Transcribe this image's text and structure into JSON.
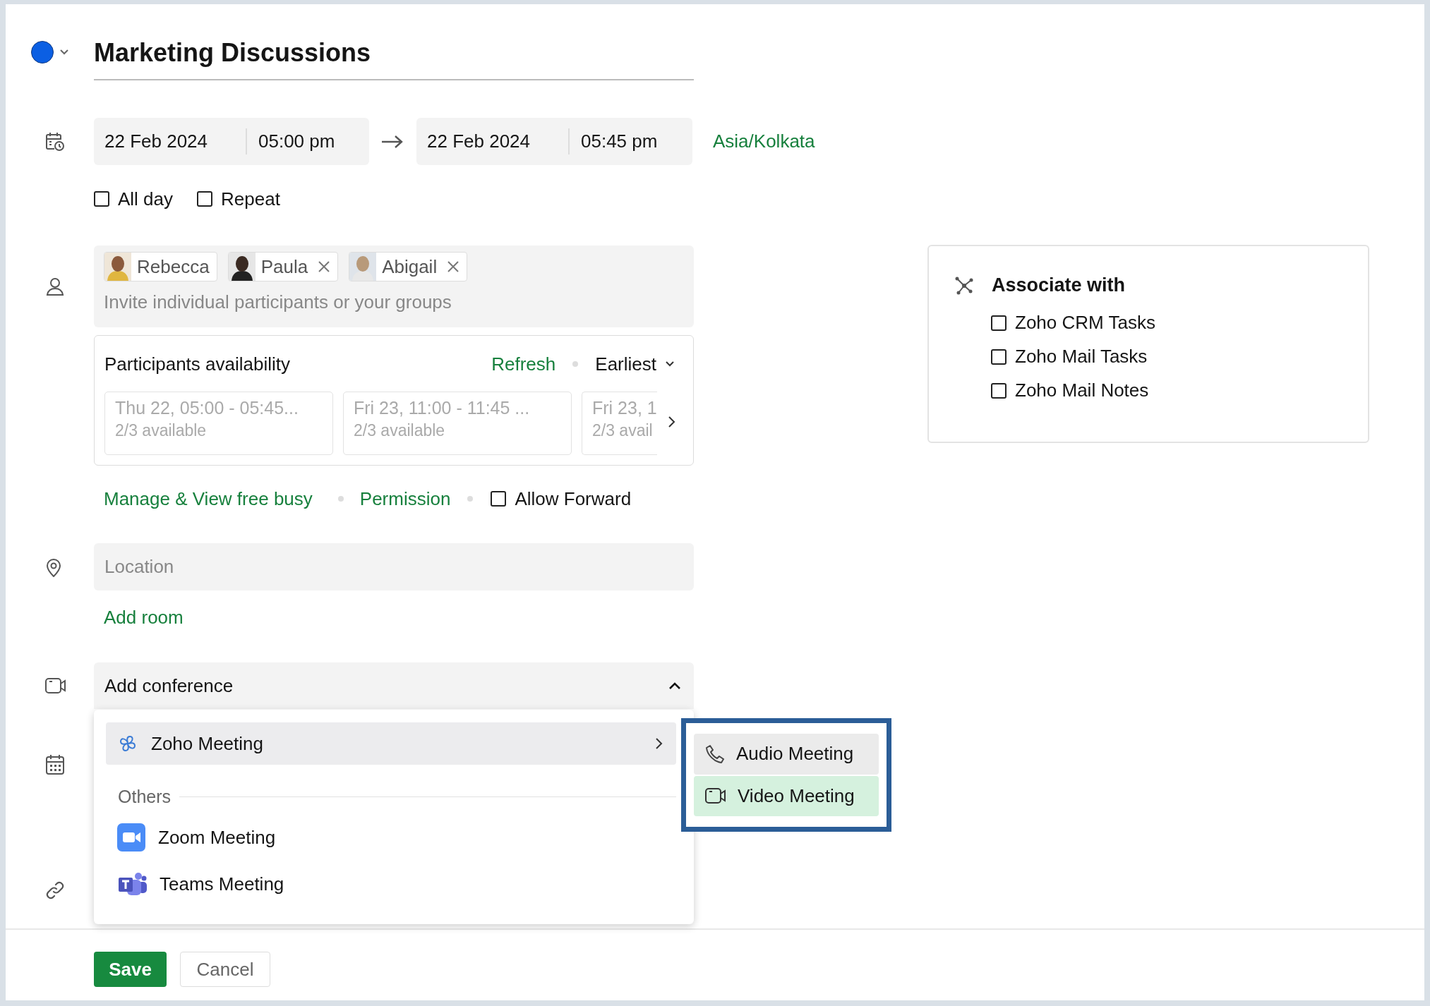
{
  "event": {
    "color": "#0b5fe3",
    "title": "Marketing Discussions"
  },
  "schedule": {
    "start_date": "22 Feb 2024",
    "start_time": "05:00 pm",
    "end_date": "22 Feb 2024",
    "end_time": "05:45 pm",
    "timezone": "Asia/Kolkata"
  },
  "options": [
    {
      "label": "All day",
      "checked": false
    },
    {
      "label": "Repeat",
      "checked": false
    }
  ],
  "participants": {
    "chips": [
      {
        "name": "Rebecca",
        "removable": false
      },
      {
        "name": "Paula",
        "removable": true
      },
      {
        "name": "Abigail",
        "removable": true
      }
    ],
    "placeholder": "Invite individual participants or your groups"
  },
  "availability": {
    "title": "Participants availability",
    "refresh": "Refresh",
    "sort": "Earliest",
    "slots": [
      {
        "time": "Thu 22, 05:00 - 05:45...",
        "count": "2/3 available"
      },
      {
        "time": "Fri 23, 11:00 - 11:45 ...",
        "count": "2/3 available"
      },
      {
        "time": "Fri 23, 1",
        "count": "2/3 avail"
      }
    ]
  },
  "links": {
    "free_busy": "Manage & View free busy",
    "permission": "Permission",
    "allow_forward": {
      "label": "Allow Forward",
      "checked": false
    }
  },
  "location": {
    "placeholder": "Location"
  },
  "add_room": "Add room",
  "conference": {
    "label": "Add conference",
    "expanded": true,
    "menu": [
      {
        "kind": "provider",
        "label": "Zoho Meeting",
        "expanded": true
      },
      {
        "kind": "heading",
        "label": "Others"
      },
      {
        "kind": "provider",
        "label": "Zoom Meeting",
        "expanded": false
      },
      {
        "kind": "provider",
        "label": "Teams Meeting",
        "expanded": false
      }
    ],
    "submenu": {
      "highlighted": true,
      "items": [
        {
          "label": "Audio Meeting",
          "selected": false
        },
        {
          "label": "Video Meeting",
          "selected": true
        }
      ]
    }
  },
  "associate": {
    "title": "Associate with",
    "items": [
      {
        "label": "Zoho CRM Tasks",
        "checked": false
      },
      {
        "label": "Zoho Mail Tasks",
        "checked": false
      },
      {
        "label": "Zoho Mail Notes",
        "checked": false
      }
    ]
  },
  "actions": {
    "save": "Save",
    "cancel": "Cancel"
  }
}
